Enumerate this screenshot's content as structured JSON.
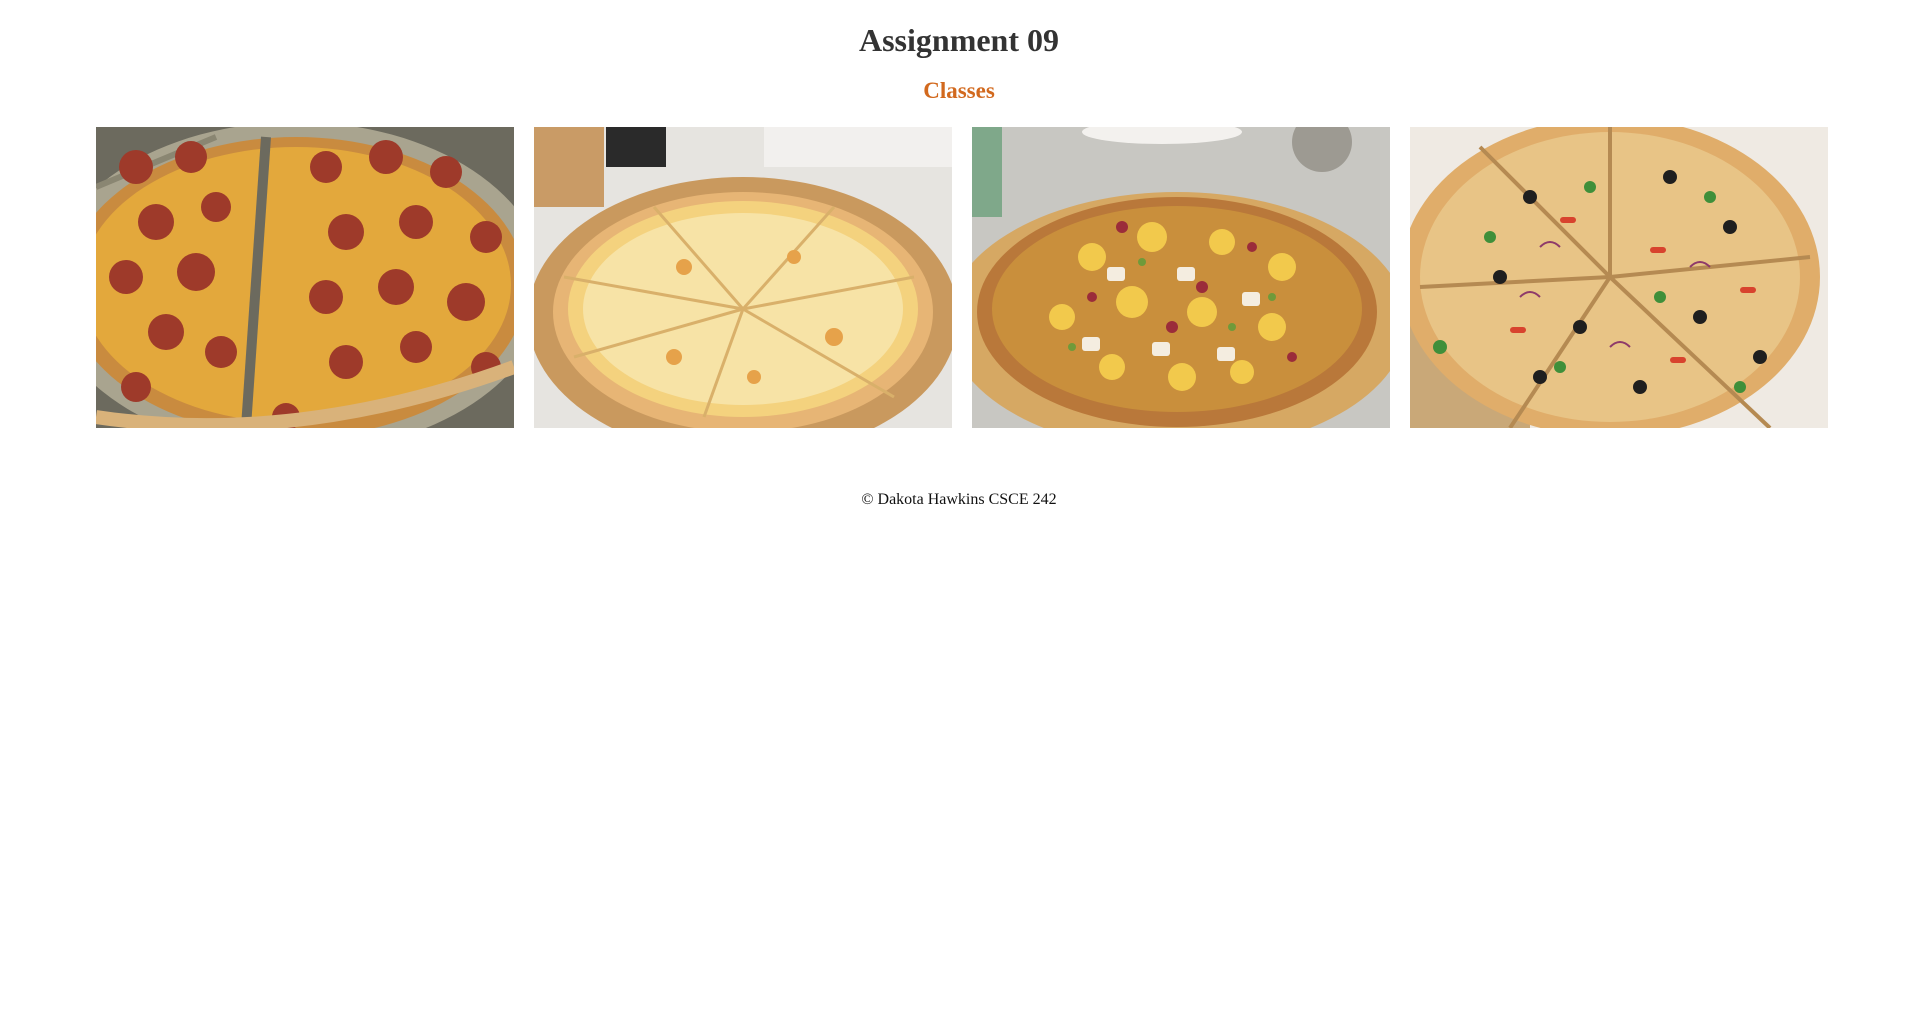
{
  "page": {
    "title": "Assignment 09",
    "subtitle": "Classes",
    "subtitle_color": "#d2691e"
  },
  "gallery": {
    "items": [
      {
        "image": "pepperoni-pizza-photo"
      },
      {
        "image": "cheese-pizza-photo"
      },
      {
        "image": "chicken-bbq-pizza-photo"
      },
      {
        "image": "veggie-pizza-photo"
      }
    ]
  },
  "footer": {
    "text": "© Dakota Hawkins CSCE 242"
  }
}
